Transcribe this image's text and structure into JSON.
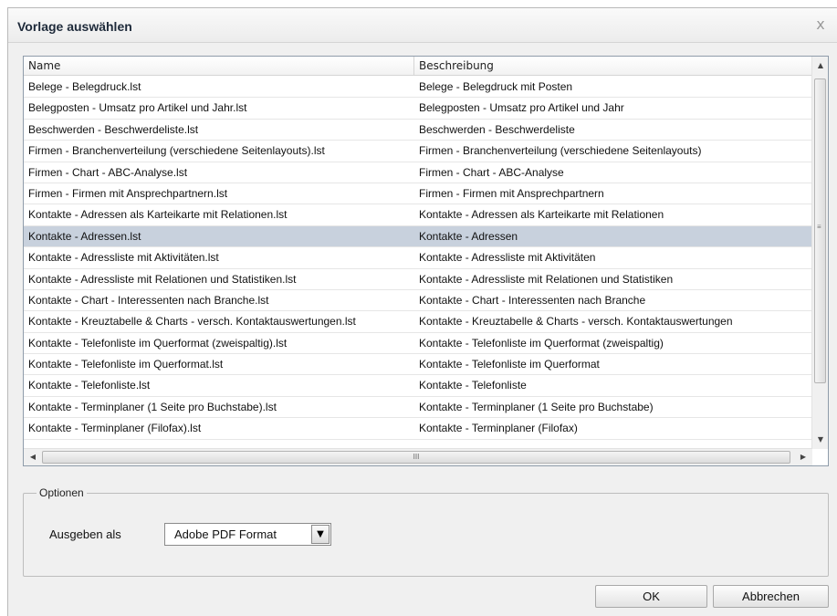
{
  "dialog": {
    "title": "Vorlage auswählen",
    "close_glyph": "x"
  },
  "table": {
    "columns": [
      "Name",
      "Beschreibung"
    ],
    "selected_index": 7,
    "rows": [
      {
        "name": "Belege - Belegdruck.lst",
        "desc": "Belege - Belegdruck mit Posten"
      },
      {
        "name": "Belegposten - Umsatz pro Artikel und Jahr.lst",
        "desc": "Belegposten - Umsatz pro Artikel und Jahr"
      },
      {
        "name": "Beschwerden - Beschwerdeliste.lst",
        "desc": "Beschwerden - Beschwerdeliste"
      },
      {
        "name": "Firmen - Branchenverteilung (verschiedene Seitenlayouts).lst",
        "desc": "Firmen - Branchenverteilung (verschiedene Seitenlayouts)"
      },
      {
        "name": "Firmen - Chart - ABC-Analyse.lst",
        "desc": "Firmen - Chart - ABC-Analyse"
      },
      {
        "name": "Firmen - Firmen mit Ansprechpartnern.lst",
        "desc": "Firmen - Firmen mit Ansprechpartnern"
      },
      {
        "name": "Kontakte - Adressen als Karteikarte mit Relationen.lst",
        "desc": "Kontakte - Adressen als Karteikarte mit Relationen"
      },
      {
        "name": "Kontakte - Adressen.lst",
        "desc": "Kontakte - Adressen"
      },
      {
        "name": "Kontakte - Adressliste mit Aktivitäten.lst",
        "desc": "Kontakte - Adressliste mit Aktivitäten"
      },
      {
        "name": "Kontakte - Adressliste mit Relationen und Statistiken.lst",
        "desc": "Kontakte - Adressliste mit Relationen und Statistiken"
      },
      {
        "name": "Kontakte - Chart - Interessenten nach Branche.lst",
        "desc": "Kontakte - Chart - Interessenten nach Branche"
      },
      {
        "name": "Kontakte - Kreuztabelle & Charts - versch. Kontaktauswertungen.lst",
        "desc": "Kontakte - Kreuztabelle & Charts - versch. Kontaktauswertungen"
      },
      {
        "name": "Kontakte - Telefonliste im Querformat (zweispaltig).lst",
        "desc": "Kontakte - Telefonliste im Querformat (zweispaltig)"
      },
      {
        "name": "Kontakte - Telefonliste im Querformat.lst",
        "desc": "Kontakte - Telefonliste im Querformat"
      },
      {
        "name": "Kontakte - Telefonliste.lst",
        "desc": "Kontakte - Telefonliste"
      },
      {
        "name": "Kontakte - Terminplaner (1 Seite pro Buchstabe).lst",
        "desc": "Kontakte - Terminplaner (1 Seite pro Buchstabe)"
      },
      {
        "name": "Kontakte - Terminplaner (Filofax).lst",
        "desc": "Kontakte - Terminplaner (Filofax)"
      }
    ],
    "scroll": {
      "up": "▲",
      "down": "▼",
      "left": "◀",
      "right": "▶",
      "grip_v": "≡",
      "grip_h": "III"
    }
  },
  "options": {
    "legend": "Optionen",
    "output_label": "Ausgeben als",
    "output_value": "Adobe PDF Format",
    "dropdown_glyph": "▼"
  },
  "buttons": {
    "ok": "OK",
    "cancel": "Abbrechen"
  }
}
